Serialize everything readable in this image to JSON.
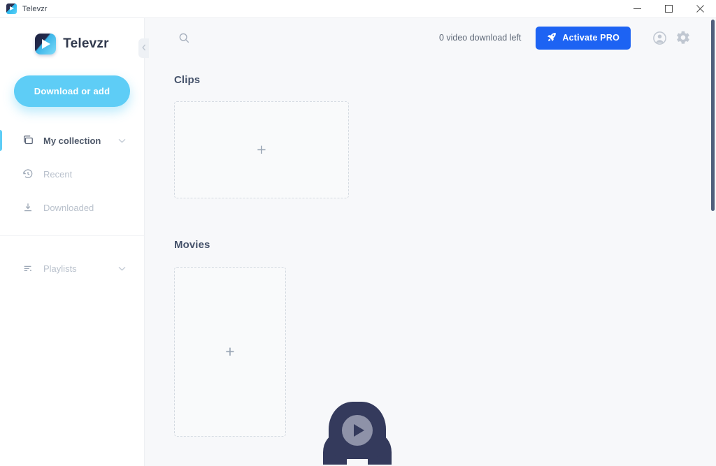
{
  "window": {
    "title": "Televzr",
    "controls": [
      {
        "name": "minimize",
        "glyph": "minimize-icon"
      },
      {
        "name": "maximize",
        "glyph": "maximize-icon"
      },
      {
        "name": "close",
        "glyph": "close-icon"
      }
    ]
  },
  "sidebar": {
    "brand": {
      "name": "Televzr",
      "logo_icon": "televzr-play-logo"
    },
    "primary_action": {
      "label": "Download or add",
      "color": "#5ecdf6"
    },
    "items": [
      {
        "label": "My collection",
        "icon": "collection-folder-icon",
        "active": true,
        "has_caret": true
      },
      {
        "label": "Recent",
        "icon": "history-clock-icon",
        "active": false,
        "has_caret": false
      },
      {
        "label": "Downloaded",
        "icon": "download-arrow-icon",
        "active": false,
        "has_caret": false
      }
    ],
    "groups": [
      {
        "label": "Playlists",
        "icon": "playlist-lines-icon",
        "active": false,
        "has_caret": true
      }
    ],
    "collapse_handle_icon": "chevron-left-icon",
    "active_indicator_color": "#5ecdf6"
  },
  "topbar": {
    "search_icon": "search-icon",
    "quota_text": "0 video download left",
    "pro_button": {
      "label": "Activate PRO",
      "icon": "rocket-icon",
      "color": "#1d63f3"
    },
    "account_icon": "account-circle-icon",
    "settings_icon": "gear-icon"
  },
  "content": {
    "sections": [
      {
        "title": "Clips",
        "placeholder_icon": "plus-icon"
      },
      {
        "title": "Movies",
        "placeholder_icon": "plus-icon"
      }
    ],
    "player_bubble": {
      "icon": "play-button-icon"
    }
  },
  "scrollbar": {
    "name": "vertical-scrollbar",
    "thumb_color": "#4f5f7c"
  }
}
